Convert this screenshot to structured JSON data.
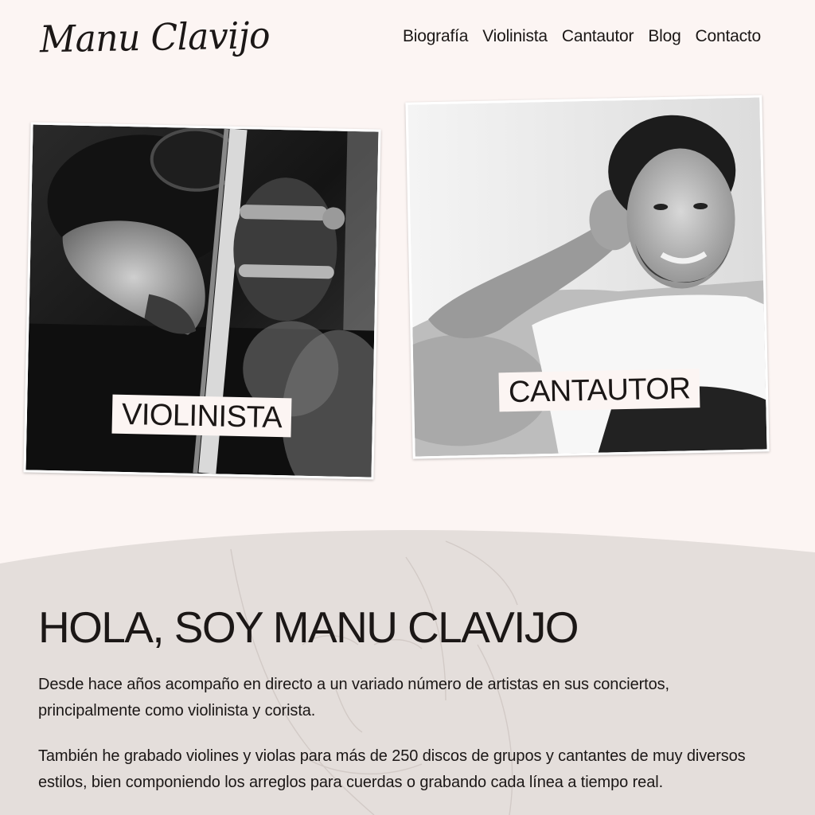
{
  "header": {
    "logo_text": "Manu Clavijo",
    "nav": [
      "Biografía",
      "Violinista",
      "Cantautor",
      "Blog",
      "Contacto"
    ]
  },
  "cards": {
    "violinista": {
      "label": "VIOLINISTA"
    },
    "cantautor": {
      "label": "CANTAUTOR"
    }
  },
  "about": {
    "title": "HOLA, SOY MANU CLAVIJO",
    "paragraph_1": "Desde hace años acompaño en directo a un variado número de artistas en sus conciertos, principalmente como violinista y corista.",
    "paragraph_2": "También he grabado violines y violas para más de 250 discos de grupos y cantantes de muy diversos estilos, bien componiendo los arreglos para cuerdas o grabando cada línea a tiempo real."
  },
  "colors": {
    "page_bg": "#fcf5f3",
    "section_bg": "#e4dedb",
    "text": "#1b1716"
  }
}
